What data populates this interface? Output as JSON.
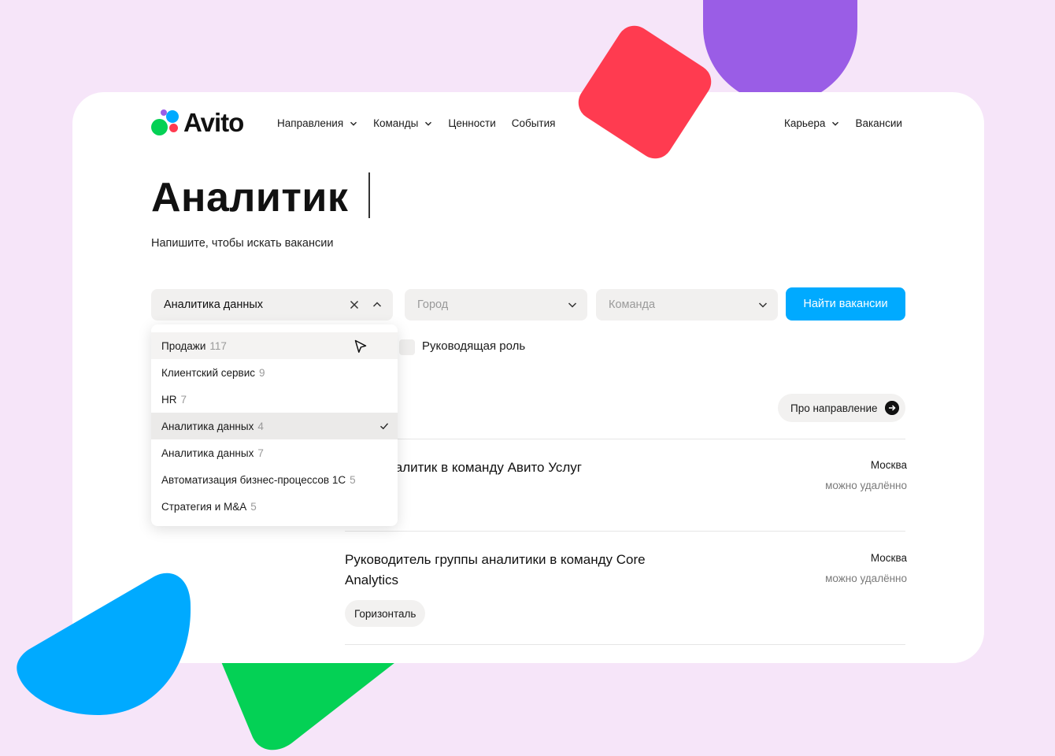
{
  "header": {
    "logo_text": "Avito",
    "nav_left": [
      {
        "label": "Направления",
        "has_chevron": true
      },
      {
        "label": "Команды",
        "has_chevron": true
      },
      {
        "label": "Ценности",
        "has_chevron": false
      },
      {
        "label": "События",
        "has_chevron": false
      }
    ],
    "nav_right": [
      {
        "label": "Карьера",
        "has_chevron": true
      },
      {
        "label": "Вакансии",
        "has_chevron": false
      }
    ]
  },
  "hero": {
    "title": "Аналитик",
    "subtitle": "Напишите, чтобы искать вакансии"
  },
  "filters": {
    "direction_value": "Аналитика данных",
    "city_placeholder": "Город",
    "team_placeholder": "Команда",
    "search_button": "Найти вакансии",
    "leadership_label": "Руководящая роль",
    "leadership_checked": false
  },
  "dropdown": {
    "items": [
      {
        "label": "Продажи",
        "count": "117",
        "state": "hover"
      },
      {
        "label": "Клиентский сервис",
        "count": "9",
        "state": "normal"
      },
      {
        "label": "HR",
        "count": "7",
        "state": "normal"
      },
      {
        "label": "Аналитика данных",
        "count": "4",
        "state": "selected"
      },
      {
        "label": "Аналитика данных",
        "count": "7",
        "state": "normal"
      },
      {
        "label": "Автоматизация бизнес-процессов 1С",
        "count": "5",
        "state": "normal"
      },
      {
        "label": "Стратегия и M&A",
        "count": "5",
        "state": "normal"
      }
    ]
  },
  "about_button": "Про направление",
  "vacancies": [
    {
      "title": "овый аналитик в команду Авито Услуг",
      "city": "Москва",
      "remote": "можно удалённо",
      "tags": []
    },
    {
      "title": "Руководитель группы аналитики в команду Core Analytics",
      "city": "Москва",
      "remote": "можно удалённо",
      "tags": [
        "Горизонталь"
      ]
    }
  ],
  "colors": {
    "background": "#f6e5f9",
    "accent_blue": "#00aaff",
    "shape_purple": "#9a5de6",
    "shape_red": "#ff3b50",
    "shape_blue": "#00aaff",
    "shape_green": "#04d155",
    "logo_dots": [
      "#04d155",
      "#00aaff",
      "#ff3b50",
      "#9a5de6"
    ]
  },
  "icons": {
    "clear": "close-icon",
    "collapse": "chevron-up-icon",
    "expand": "chevron-down-icon",
    "selected": "check-icon",
    "pointer": "cursor-arrow-icon",
    "about": "arrow-right-circle-icon"
  }
}
